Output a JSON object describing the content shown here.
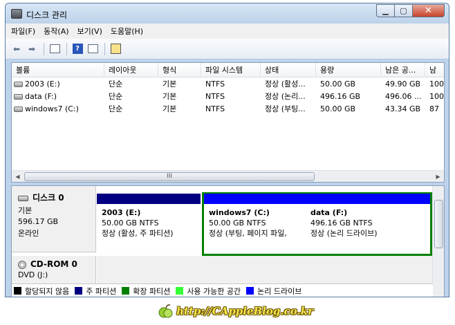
{
  "window": {
    "title": "디스크 관리"
  },
  "menu": [
    "파일(F)",
    "동작(A)",
    "보기(V)",
    "도움말(H)"
  ],
  "volume_table": {
    "columns": [
      "볼륨",
      "레이아웃",
      "형식",
      "파일 시스템",
      "상태",
      "용량",
      "남은 공...",
      "남"
    ],
    "rows": [
      [
        "2003 (E:)",
        "단순",
        "기본",
        "NTFS",
        "정상 (활성...",
        "50.00 GB",
        "49.90 GB",
        "100"
      ],
      [
        "data (F:)",
        "단순",
        "기본",
        "NTFS",
        "정상 (논리...",
        "496.16 GB",
        "496.06 ...",
        "100"
      ],
      [
        "windows7 (C:)",
        "단순",
        "기본",
        "NTFS",
        "정상 (부팅...",
        "50.00 GB",
        "43.34 GB",
        "87"
      ]
    ],
    "scroll_grip": "III"
  },
  "disk0": {
    "name": "디스크 0",
    "type": "기본",
    "size": "596.17 GB",
    "status": "온라인",
    "partitions": [
      {
        "name": "2003  (E:)",
        "size": "50.00 GB NTFS",
        "status": "정상 (활성, 주 파티션)",
        "bar_color": "#000080"
      },
      {
        "name": "windows7  (C:)",
        "size": "50.00 GB NTFS",
        "status": "정상 (부팅, 페이지 파일,",
        "bar_color": "#0000ff"
      },
      {
        "name": "data  (F:)",
        "size": "496.16 GB NTFS",
        "status": "정상 (논리 드라이브)",
        "bar_color": "#0000ff"
      }
    ]
  },
  "cdrom0": {
    "name": "CD-ROM 0",
    "type": "DVD (J:)"
  },
  "legend": [
    {
      "label": "할당되지 않음",
      "color": "#000000"
    },
    {
      "label": "주 파티션",
      "color": "#000080"
    },
    {
      "label": "확장 파티션",
      "color": "#008000"
    },
    {
      "label": "사용 가능한 공간",
      "color": "#33ff33"
    },
    {
      "label": "논리 드라이브",
      "color": "#0000ff"
    }
  ],
  "watermark": {
    "text": "http://CAppleBlog.co.kr"
  },
  "icons": {
    "back": "back-arrow-icon",
    "forward": "forward-arrow-icon",
    "console": "console-tree-icon",
    "help": "help-icon",
    "panel": "action-pane-icon",
    "properties": "properties-icon"
  }
}
